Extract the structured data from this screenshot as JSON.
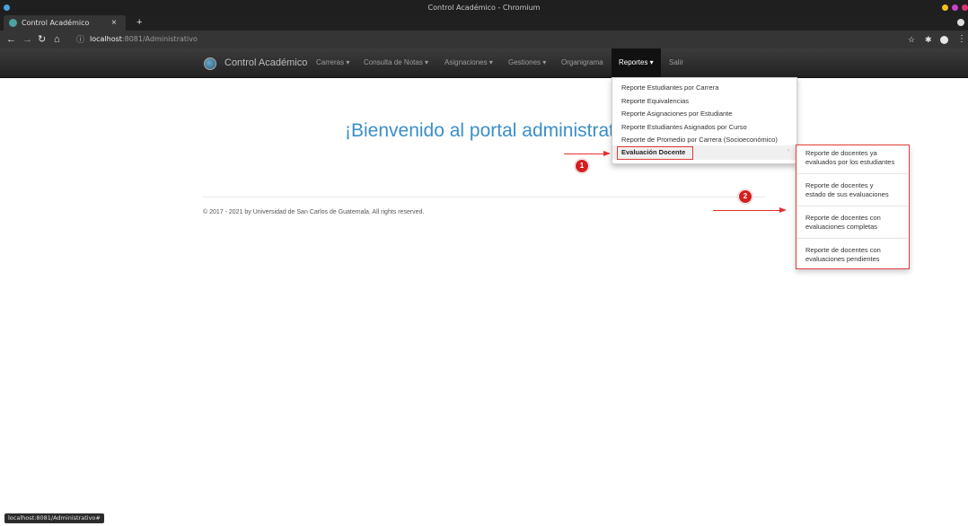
{
  "browser": {
    "window_title": "Control Académico - Chromium",
    "tab_title": "Control Académico",
    "tab_close": "×",
    "new_tab": "+",
    "url_host": "localhost",
    "url_rest": ":8081/Administrativo",
    "status_url": "localhost:8081/Administrativo#"
  },
  "navbar": {
    "brand": "Control Académico",
    "items": [
      {
        "label": "Carreras ▾"
      },
      {
        "label": "Consulta de Notas ▾"
      },
      {
        "label": "Asignaciones ▾"
      },
      {
        "label": "Gestiones ▾"
      },
      {
        "label": "Organigrama"
      },
      {
        "label": "Reportes ▾"
      },
      {
        "label": "Salir"
      }
    ]
  },
  "main": {
    "welcome": "¡Bienvenido al portal administrativo",
    "footer": "© 2017 - 2021 by Universidad de San Carlos de Guatemala. All rights reserved."
  },
  "reportes_menu": {
    "items": [
      "Reporte Estudiantes por Carrera",
      "Reporte Equivalencias",
      "Reporte Asignaciones por Estudiante",
      "Reporte Estudiantes Asignados por Curso",
      "Reporte de Promedio por Carrera (Socioeconómico)"
    ],
    "highlight": "Evaluación Docente"
  },
  "evaluacion_submenu": {
    "items": [
      {
        "line1": "Reporte de docentes ya",
        "line2": "evaluados por los estudiantes"
      },
      {
        "line1": "Reporte de docentes y",
        "line2": "estado de sus evaluaciones"
      },
      {
        "line1": "Reporte de docentes con",
        "line2": "evaluaciones completas"
      },
      {
        "line1": "Reporte de docentes con",
        "line2": "evaluaciones pendientes"
      }
    ]
  },
  "annotations": {
    "step1": "1",
    "step2": "2"
  },
  "colors": {
    "accent": "#3b8ec9",
    "annotation": "#e23b3b",
    "navbar": "#222222"
  }
}
